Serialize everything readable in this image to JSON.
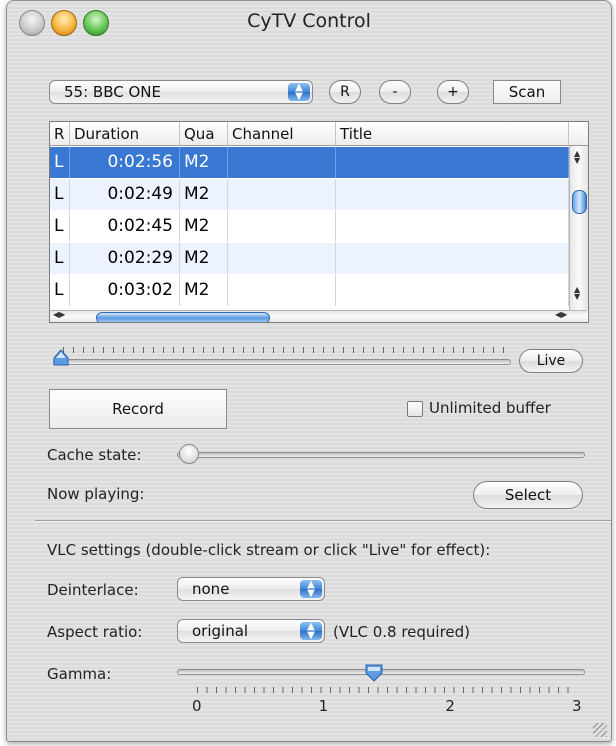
{
  "window": {
    "title": "CyTV Control"
  },
  "toolbar": {
    "channel_selected": "55: BBC ONE",
    "r_label": "R",
    "minus_label": "-",
    "plus_label": "+",
    "scan_label": "Scan"
  },
  "table": {
    "headers": [
      "R",
      "Duration",
      "Qua",
      "Channel",
      "Title"
    ],
    "rows": [
      {
        "r": "L",
        "duration": "0:02:56",
        "qua": "M2",
        "channel": "",
        "title": ""
      },
      {
        "r": "L",
        "duration": "0:02:49",
        "qua": "M2",
        "channel": "",
        "title": ""
      },
      {
        "r": "L",
        "duration": "0:02:45",
        "qua": "M2",
        "channel": "",
        "title": ""
      },
      {
        "r": "L",
        "duration": "0:02:29",
        "qua": "M2",
        "channel": "",
        "title": ""
      },
      {
        "r": "L",
        "duration": "0:03:02",
        "qua": "M2",
        "channel": "",
        "title": ""
      }
    ],
    "selected_row": 0
  },
  "playback": {
    "live_label": "Live",
    "position": 0
  },
  "record": {
    "record_label": "Record",
    "unlimited_buffer_label": "Unlimited buffer",
    "unlimited_buffer_checked": false
  },
  "cache": {
    "label": "Cache state:",
    "level": 0
  },
  "now_playing": {
    "label": "Now playing:",
    "value": "",
    "select_label": "Select"
  },
  "vlc": {
    "heading": "VLC settings (double-click stream or click \"Live\" for effect):",
    "deinterlace_label": "Deinterlace:",
    "deinterlace_value": "none",
    "aspect_label": "Aspect ratio:",
    "aspect_value": "original",
    "aspect_note": "(VLC 0.8 required)",
    "gamma_label": "Gamma:",
    "gamma_ticks": [
      "0",
      "1",
      "2",
      "3"
    ],
    "gamma_value": 1.4,
    "gamma_min": 0,
    "gamma_max": 3
  },
  "colors": {
    "selection": "#3a79d3",
    "alt_row": "#edf3fe",
    "aqua_blue": "#3f86d8"
  }
}
